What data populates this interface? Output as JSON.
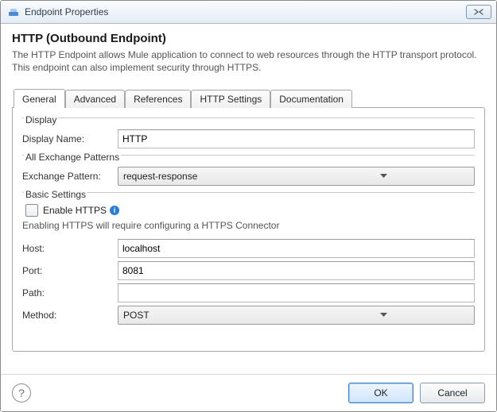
{
  "window": {
    "title": "Endpoint Properties"
  },
  "header": {
    "title": "HTTP (Outbound Endpoint)",
    "description": "The HTTP Endpoint allows Mule application to connect to web resources through the HTTP transport protocol. This endpoint can also implement security through HTTPS."
  },
  "tabs": {
    "general": "General",
    "advanced": "Advanced",
    "references": "References",
    "http_settings": "HTTP Settings",
    "documentation": "Documentation",
    "active": "general"
  },
  "groups": {
    "display": {
      "legend": "Display",
      "display_name_label": "Display Name:",
      "display_name_value": "HTTP"
    },
    "exchange": {
      "legend": "All Exchange Patterns",
      "pattern_label": "Exchange Pattern:",
      "pattern_value": "request-response"
    },
    "basic": {
      "legend": "Basic Settings",
      "enable_https_label": "Enable HTTPS",
      "enable_https_checked": false,
      "https_note": "Enabling HTTPS will require configuring a HTTPS Connector",
      "host_label": "Host:",
      "host_value": "localhost",
      "port_label": "Port:",
      "port_value": "8081",
      "path_label": "Path:",
      "path_value": "",
      "method_label": "Method:",
      "method_value": "POST"
    }
  },
  "footer": {
    "ok": "OK",
    "cancel": "Cancel"
  }
}
